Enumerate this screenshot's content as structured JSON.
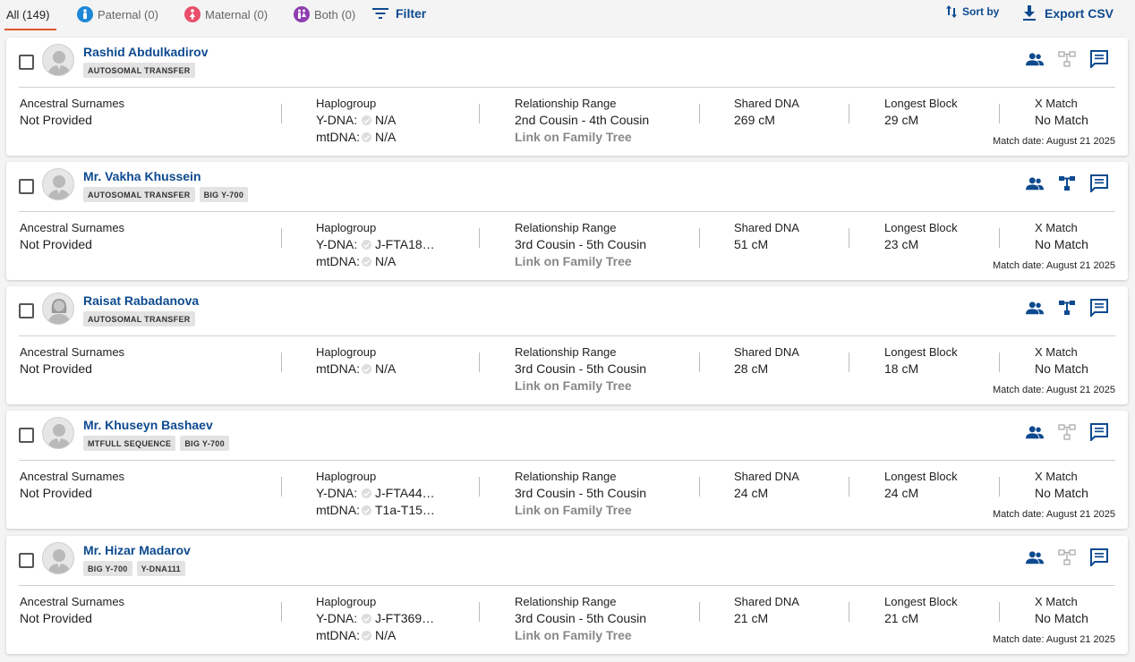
{
  "toolbar": {
    "all_label": "All (149)",
    "paternal_label": "Paternal (0)",
    "maternal_label": "Maternal (0)",
    "both_label": "Both (0)",
    "filter_label": "Filter",
    "sort_label": "Sort by",
    "export_label": "Export CSV",
    "colors": {
      "accent": "#0d4a8f",
      "paternal": "#1e88d6",
      "maternal": "#e94f6a",
      "both": "#8e3fb0",
      "tab_underline": "#e0552e"
    }
  },
  "labels": {
    "ancestral": "Ancestral Surnames",
    "haplogroup": "Haplogroup",
    "relationship": "Relationship Range",
    "shared": "Shared DNA",
    "longest": "Longest Block",
    "xmatch": "X Match",
    "ydna": "Y-DNA:",
    "mtdna": "mtDNA:",
    "link_tree": "Link on Family Tree"
  },
  "matches": [
    {
      "name": "Rashid Abdulkadirov",
      "tags": [
        "AUTOSOMAL TRANSFER"
      ],
      "ancestral": "Not Provided",
      "ydna": "N/A",
      "mtdna": "N/A",
      "relationship": "2nd Cousin - 4th Cousin",
      "shared": "269 cM",
      "longest": "29 cM",
      "xmatch": "No Match",
      "match_date": "Match date: August 21 2025"
    },
    {
      "name": "Mr. Vakha Khussein",
      "tags": [
        "AUTOSOMAL TRANSFER",
        "BIG Y-700"
      ],
      "ancestral": "Not Provided",
      "ydna": "J-FTA18…",
      "mtdna": "N/A",
      "relationship": "3rd Cousin - 5th Cousin",
      "shared": "51 cM",
      "longest": "23 cM",
      "xmatch": "No Match",
      "match_date": "Match date: August 21 2025"
    },
    {
      "name": "Raisat Rabadanova",
      "tags": [
        "AUTOSOMAL TRANSFER"
      ],
      "ancestral": "Not Provided",
      "mtdna": "N/A",
      "relationship": "3rd Cousin - 5th Cousin",
      "shared": "28 cM",
      "longest": "18 cM",
      "xmatch": "No Match",
      "match_date": "Match date: August 21 2025"
    },
    {
      "name": "Mr. Khuseyn Bashaev",
      "tags": [
        "MTFULL SEQUENCE",
        "BIG Y-700"
      ],
      "ancestral": "Not Provided",
      "ydna": "J-FTA44…",
      "mtdna": "T1a-T15…",
      "relationship": "3rd Cousin - 5th Cousin",
      "shared": "24 cM",
      "longest": "24 cM",
      "xmatch": "No Match",
      "match_date": "Match date: August 21 2025"
    },
    {
      "name": "Mr. Hizar Madarov",
      "tags": [
        "BIG Y-700",
        "Y-DNA111"
      ],
      "ancestral": "Not Provided",
      "ydna": "J-FT369…",
      "mtdna": "N/A",
      "relationship": "3rd Cousin - 5th Cousin",
      "shared": "21 cM",
      "longest": "21 cM",
      "xmatch": "No Match",
      "match_date": "Match date: August 21 2025"
    }
  ]
}
